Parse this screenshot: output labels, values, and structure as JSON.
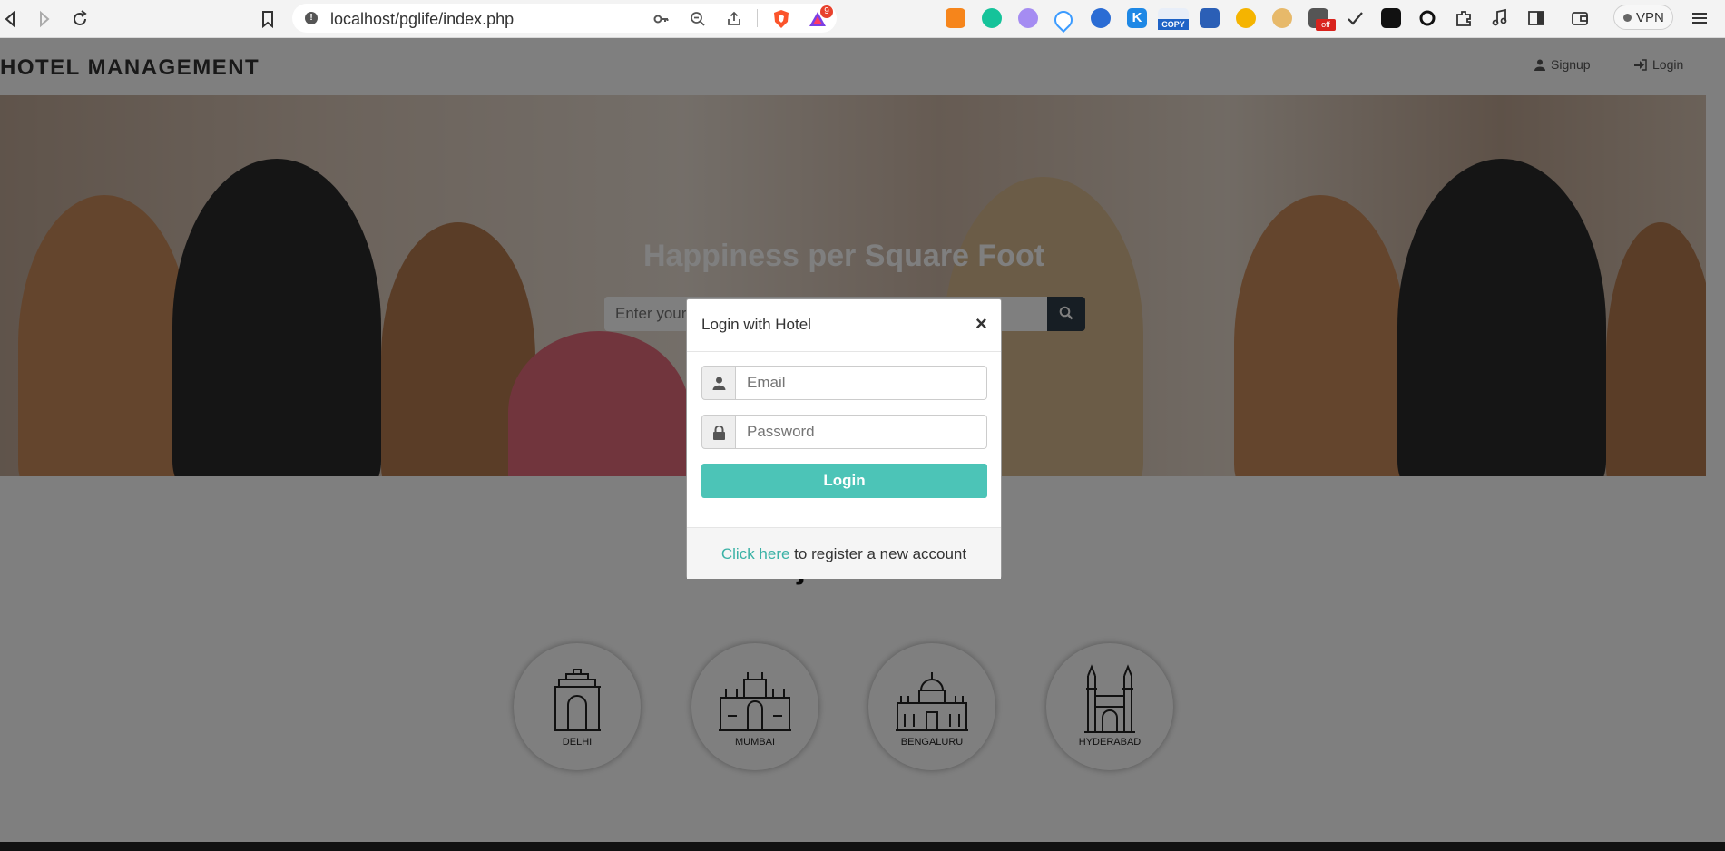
{
  "browser": {
    "url": "localhost/pglife/index.php",
    "badge_count": "9",
    "ext_copy_label": "COPY",
    "ext_off_label": "off",
    "vpn_label": "VPN"
  },
  "header": {
    "brand": "HOTEL MANAGEMENT",
    "signup_label": "Signup",
    "login_label": "Login"
  },
  "hero": {
    "title": "Happiness per Square Foot",
    "search_placeholder": "Enter your city to search for PGs"
  },
  "cities": {
    "title": "Major Cities",
    "items": [
      {
        "label": "DELHI",
        "icon": "india-gate-icon"
      },
      {
        "label": "MUMBAI",
        "icon": "gateway-of-india-icon"
      },
      {
        "label": "BENGALURU",
        "icon": "vidhana-soudha-icon"
      },
      {
        "label": "HYDERABAD",
        "icon": "charminar-icon"
      }
    ]
  },
  "modal": {
    "title": "Login with Hotel",
    "close_symbol": "×",
    "email_placeholder": "Email",
    "password_placeholder": "Password",
    "login_button": "Login",
    "register_link": "Click here",
    "register_text": " to register a new account"
  },
  "colors": {
    "accent": "#4cc4b7",
    "link": "#3bb2a6",
    "search_button": "#2f3d48"
  }
}
